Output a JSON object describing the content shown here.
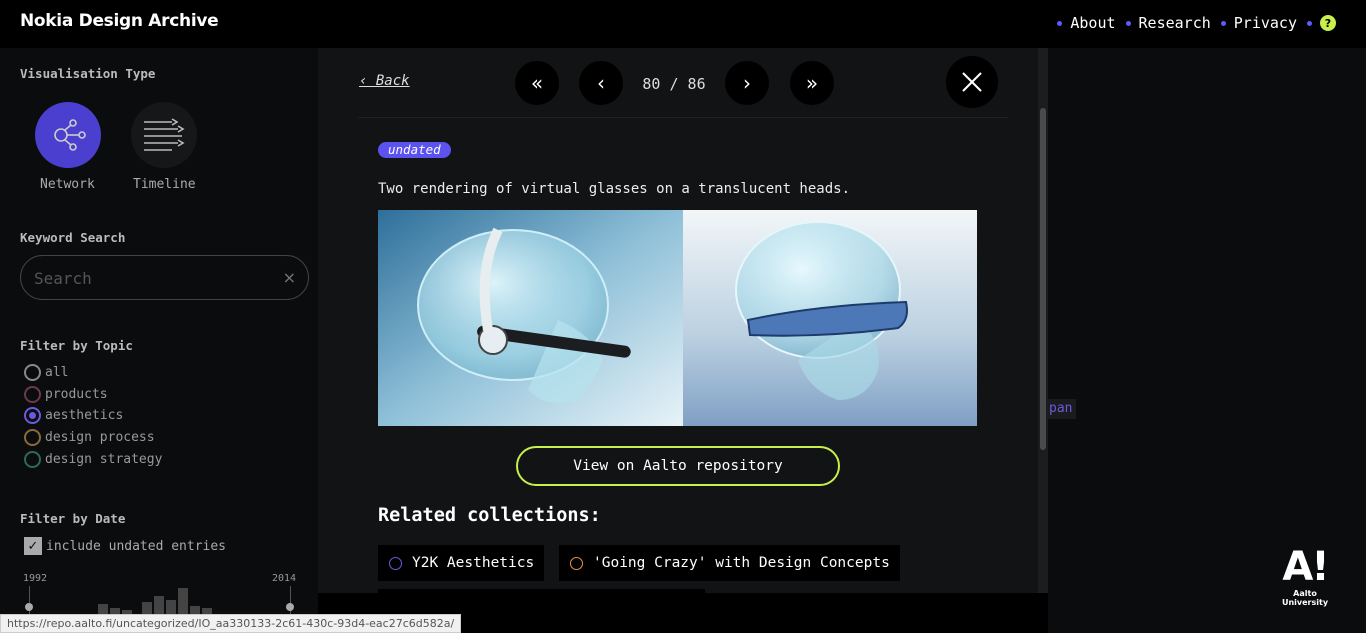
{
  "header": {
    "brand": "Nokia Design Archive",
    "nav": [
      {
        "label": "About"
      },
      {
        "label": "Research"
      },
      {
        "label": "Privacy"
      }
    ],
    "help_label": "?"
  },
  "sidebar": {
    "viz_title": "Visualisation Type",
    "viz_network": "Network",
    "viz_timeline": "Timeline",
    "keyword_title": "Keyword Search",
    "search_placeholder": "Search",
    "clear_symbol": "×",
    "topic_title": "Filter by Topic",
    "topics": [
      {
        "label": "all",
        "color": "#888888"
      },
      {
        "label": "products",
        "color": "#6b3a4a"
      },
      {
        "label": "aesthetics",
        "color": "#6a5ae0"
      },
      {
        "label": "design process",
        "color": "#8a6a3a"
      },
      {
        "label": "design strategy",
        "color": "#2f6a52"
      }
    ],
    "date_title": "Filter by Date",
    "undated_label": "include undated entries",
    "year_start": "1992",
    "year_end": "2014"
  },
  "modal": {
    "back_label": "‹ Back",
    "first_symbol": "«",
    "prev_symbol": "‹",
    "next_symbol": "›",
    "last_symbol": "»",
    "page_current": "80",
    "page_total": "86",
    "page_text": "80 / 86",
    "badge": "undated",
    "description": "Two rendering of virtual glasses on a translucent heads.",
    "repo_button": "View on Aalto repository",
    "related_title": "Related collections:",
    "collections": [
      {
        "label": "Y2K Aesthetics",
        "color": "#6a5ae0"
      },
      {
        "label": "'Going Crazy' with Design Concepts",
        "color": "#e8914a"
      }
    ]
  },
  "background": {
    "span_chip": "pan"
  },
  "aalto": {
    "logo": "A!",
    "sub": "Aalto University"
  },
  "status_bar": {
    "url": "https://repo.aalto.fi/uncategorized/IO_aa330133-2c61-430c-93d4-eac27c6d582a/"
  }
}
